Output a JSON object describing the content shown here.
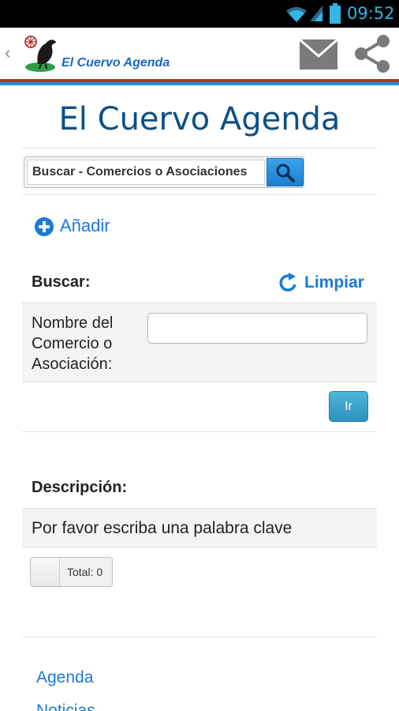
{
  "status_bar": {
    "time": "09:52"
  },
  "action_bar": {
    "brand": "El Cuervo Agenda"
  },
  "colors": {
    "accent": "#1a7ad6",
    "title": "#0d4f85",
    "brand_red": "#d6202a",
    "brand_blue": "#2b88d8"
  },
  "page": {
    "title": "El Cuervo Agenda"
  },
  "search": {
    "value": "Buscar - Comercios o Asociaciones"
  },
  "add": {
    "label": "Añadir"
  },
  "filter": {
    "heading": "Buscar:",
    "clear_label": "Limpiar",
    "name_label": "Nombre del Comercio o Asociación:",
    "name_value": "",
    "submit_label": "Ir"
  },
  "description": {
    "heading": "Descripción:",
    "text": "Por favor escriba una palabra clave"
  },
  "results": {
    "total": "Total: 0"
  },
  "footer_links": [
    "Agenda",
    "Noticias"
  ],
  "icons": [
    "wifi-icon",
    "signal-icon",
    "battery-icon",
    "back-icon",
    "raven-logo",
    "mail-icon",
    "share-icon",
    "search-icon",
    "add-icon",
    "refresh-icon"
  ]
}
